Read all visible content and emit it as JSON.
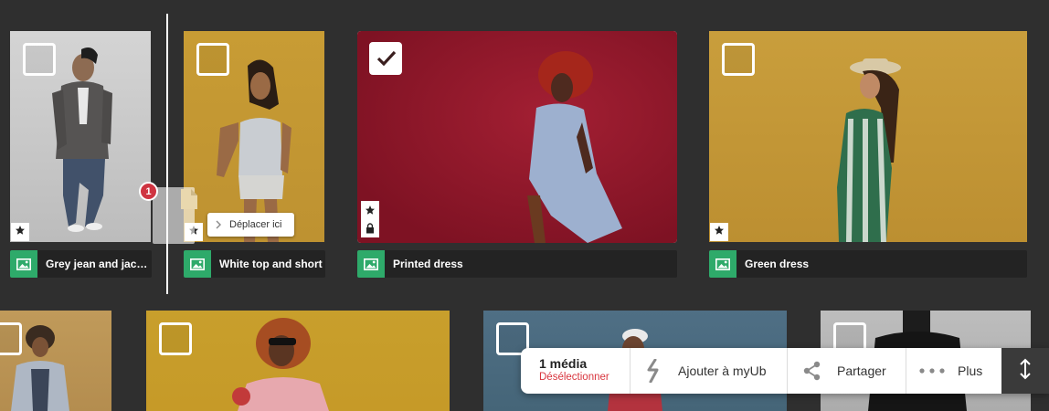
{
  "media": [
    {
      "title": "Grey jean and jac…",
      "selected": false,
      "badges": [
        "star"
      ]
    },
    {
      "title": "White top and short",
      "selected": false,
      "badges": [
        "star"
      ]
    },
    {
      "title": "Printed dress",
      "selected": true,
      "badges": [
        "star",
        "lock"
      ]
    },
    {
      "title": "Green dress",
      "selected": false,
      "badges": [
        "star"
      ]
    }
  ],
  "drag": {
    "count": "1",
    "tooltip": "Déplacer ici"
  },
  "action_bar": {
    "count_label": "1 média",
    "deselect_label": "Désélectionner",
    "add_label": "Ajouter à myUb",
    "share_label": "Partager",
    "more_label": "Plus"
  },
  "colors": {
    "background": "#2f2f2f",
    "caption_bg": "#232323",
    "image_type_icon": "#2eaa6a",
    "deselect": "#d8353e",
    "drag_count": "#cf3441"
  }
}
